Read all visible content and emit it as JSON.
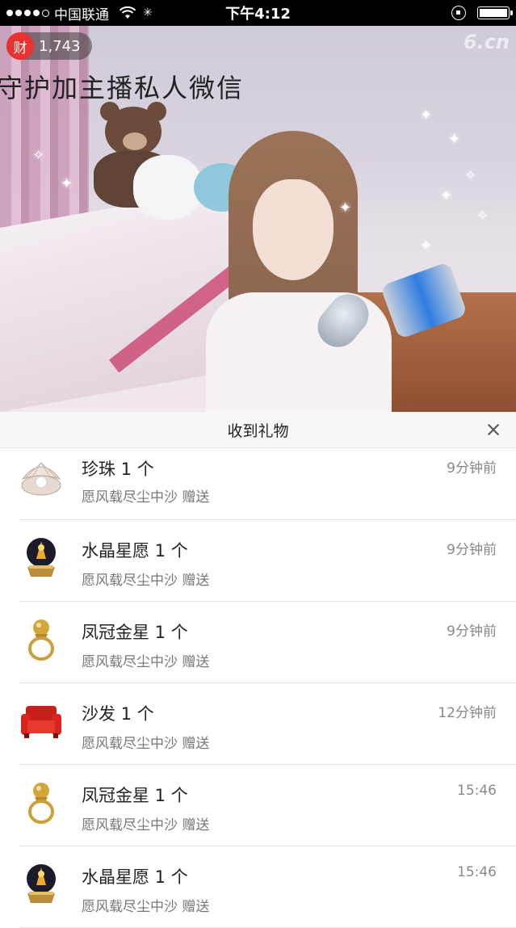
{
  "status_bar": {
    "carrier": "中国联通",
    "time": "下午4:12"
  },
  "video": {
    "overlay_text": "守护加主播私人微信",
    "wealth_badge": {
      "icon_label": "财",
      "count": "1,743"
    },
    "logo": "6.cn"
  },
  "panel": {
    "title": "收到礼物",
    "gifts": [
      {
        "name": "珍珠 1 个",
        "sender": "愿风载尽尘中沙 赠送",
        "time": "9分钟前",
        "icon": "pearl-icon"
      },
      {
        "name": "水晶星愿 1 个",
        "sender": "愿风载尽尘中沙 赠送",
        "time": "9分钟前",
        "icon": "crystal-ball-icon"
      },
      {
        "name": "凤冠金星 1 个",
        "sender": "愿风载尽尘中沙 赠送",
        "time": "9分钟前",
        "icon": "gold-ring-icon"
      },
      {
        "name": "沙发 1 个",
        "sender": "愿风载尽尘中沙 赠送",
        "time": "12分钟前",
        "icon": "sofa-icon"
      },
      {
        "name": "凤冠金星 1 个",
        "sender": "愿风载尽尘中沙 赠送",
        "time": "15:46",
        "icon": "gold-ring-icon"
      },
      {
        "name": "水晶星愿 1 个",
        "sender": "愿风载尽尘中沙 赠送",
        "time": "15:46",
        "icon": "crystal-ball-icon"
      }
    ]
  },
  "colors": {
    "badge_red": "#e8322e",
    "sofa_red": "#d9231e",
    "gold": "#c9a03a"
  }
}
